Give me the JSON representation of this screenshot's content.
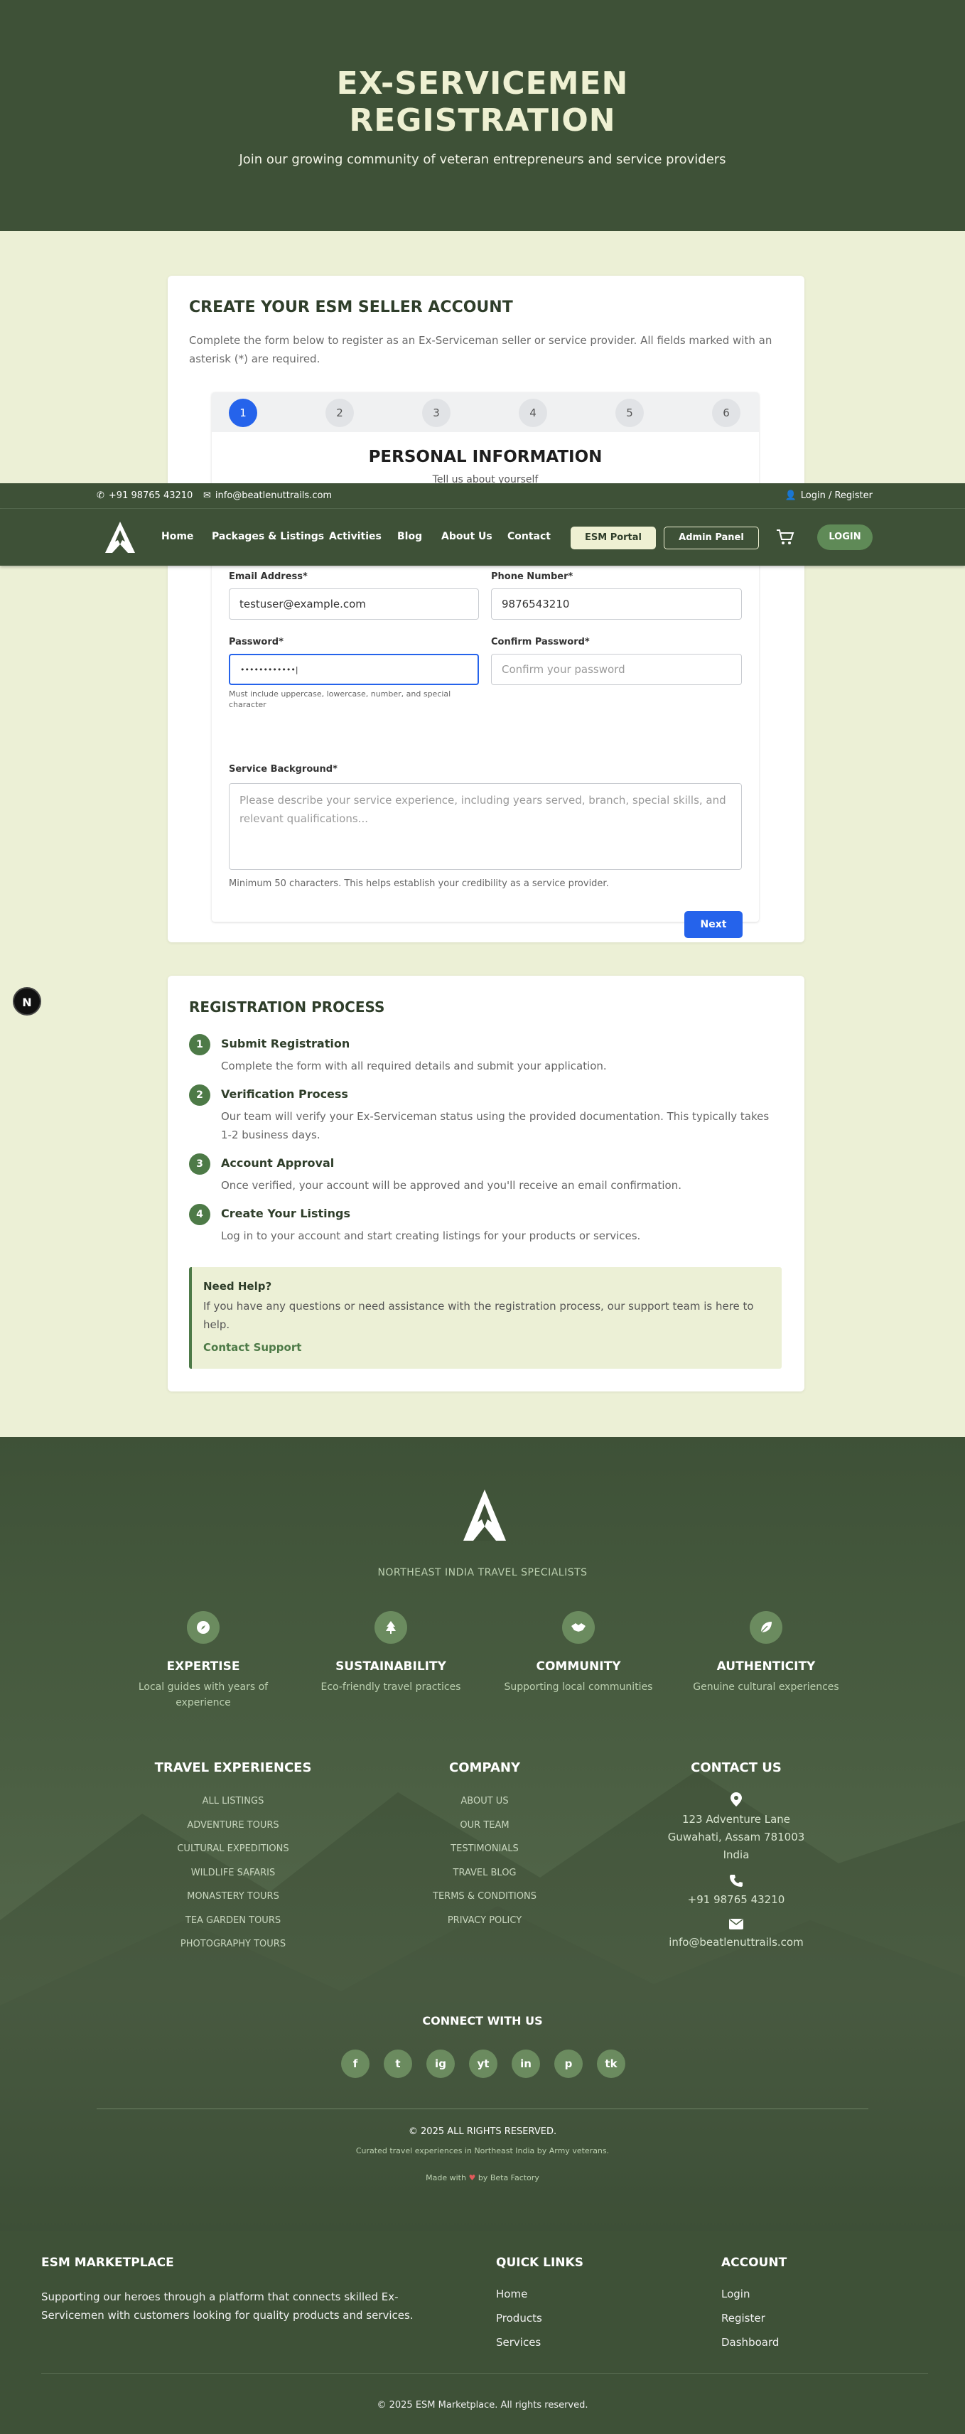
{
  "hero": {
    "title_line1": "EX-SERVICEMEN",
    "title_line2": "REGISTRATION",
    "subtitle": "Join our growing community of veteran entrepreneurs and service providers"
  },
  "form": {
    "title": "CREATE YOUR ESM SELLER ACCOUNT",
    "description": "Complete the form below to register as an Ex-Serviceman seller or service provider. All fields marked with an asterisk (*) are required.",
    "steps": [
      "1",
      "2",
      "3",
      "4",
      "5",
      "6"
    ],
    "active_step": 1,
    "section_title": "PERSONAL INFORMATION",
    "section_subtitle": "Tell us about yourself",
    "email_label": "Email Address*",
    "email_value": "testuser@example.com",
    "phone_label": "Phone Number*",
    "phone_value": "9876543210",
    "password_label": "Password*",
    "password_value": "••••••••••••|",
    "password_hint": "Must include uppercase, lowercase, number, and special character",
    "confirm_label": "Confirm Password*",
    "confirm_placeholder": "Confirm your password",
    "background_label": "Service Background*",
    "background_placeholder": "Please describe your service experience, including years served, branch, special skills, and relevant qualifications...",
    "background_hint": "Minimum 50 characters. This helps establish your credibility as a service provider.",
    "next_label": "Next"
  },
  "topbar": {
    "phone": "+91 98765 43210",
    "email": "info@beatlenuttrails.com",
    "login": "Login / Register"
  },
  "nav": {
    "items": [
      "Home",
      "Packages & Listings",
      "Activities",
      "Blog",
      "About Us",
      "Contact"
    ],
    "esm_portal": "ESM Portal",
    "admin_panel": "Admin Panel",
    "login": "LOGIN"
  },
  "floating_badge": "N",
  "process": {
    "title": "REGISTRATION PROCESS",
    "steps": [
      {
        "num": "1",
        "title": "Submit Registration",
        "desc": "Complete the form with all required details and submit your application."
      },
      {
        "num": "2",
        "title": "Verification Process",
        "desc": "Our team will verify your Ex-Serviceman status using the provided documentation. This typically takes 1-2 business days."
      },
      {
        "num": "3",
        "title": "Account Approval",
        "desc": "Once verified, your account will be approved and you'll receive an email confirmation."
      },
      {
        "num": "4",
        "title": "Create Your Listings",
        "desc": "Log in to your account and start creating listings for your products or services."
      }
    ],
    "help_title": "Need Help?",
    "help_desc": "If you have any questions or need assistance with the registration process, our support team is here to help.",
    "help_link": "Contact Support"
  },
  "footer": {
    "tagline": "NORTHEAST INDIA TRAVEL SPECIALISTS",
    "features": [
      {
        "title": "EXPERTISE",
        "desc": "Local guides with years of experience",
        "icon": "compass-icon"
      },
      {
        "title": "SUSTAINABILITY",
        "desc": "Eco-friendly travel practices",
        "icon": "tree-icon"
      },
      {
        "title": "COMMUNITY",
        "desc": "Supporting local communities",
        "icon": "handshake-icon"
      },
      {
        "title": "AUTHENTICITY",
        "desc": "Genuine cultural experiences",
        "icon": "leaf-icon"
      }
    ],
    "travel_title": "TRAVEL EXPERIENCES",
    "travel_links": [
      "ALL LISTINGS",
      "ADVENTURE TOURS",
      "CULTURAL EXPEDITIONS",
      "WILDLIFE SAFARIS",
      "MONASTERY TOURS",
      "TEA GARDEN TOURS",
      "PHOTOGRAPHY TOURS"
    ],
    "company_title": "COMPANY",
    "company_links": [
      "ABOUT US",
      "OUR TEAM",
      "TESTIMONIALS",
      "TRAVEL BLOG",
      "TERMS & CONDITIONS",
      "PRIVACY POLICY"
    ],
    "contact_title": "CONTACT US",
    "address_line1": "123 Adventure Lane",
    "address_line2": "Guwahati, Assam 781003",
    "address_line3": "India",
    "phone": "+91 98765 43210",
    "email": "info@beatlenuttrails.com",
    "connect_title": "CONNECT WITH US",
    "socials": [
      "f",
      "t",
      "ig",
      "yt",
      "in",
      "p",
      "tk"
    ],
    "copyright": "© 2025 ALL RIGHTS RESERVED.",
    "curated": "Curated travel experiences in Northeast India by Army veterans.",
    "made_prefix": "Made with",
    "made_suffix": "by Beta Factory"
  },
  "footer2": {
    "brand": "ESM MARKETPLACE",
    "desc": "Supporting our heroes through a platform that connects skilled Ex-Servicemen with customers looking for quality products and services.",
    "quick_title": "QUICK LINKS",
    "quick_links": [
      "Home",
      "Products",
      "Services"
    ],
    "account_title": "ACCOUNT",
    "account_links": [
      "Login",
      "Register",
      "Dashboard"
    ],
    "copyright": "© 2025 ESM Marketplace. All rights reserved."
  },
  "colors": {
    "dark_green": "#3e5137",
    "cream": "#ecf0d6",
    "accent_green": "#4d7a47",
    "blue": "#2563eb"
  }
}
